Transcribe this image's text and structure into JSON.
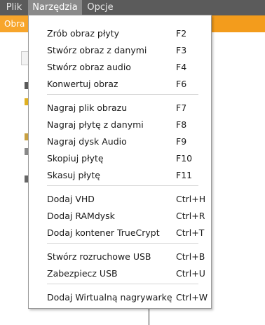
{
  "menubar": {
    "items": [
      {
        "label": "Plik"
      },
      {
        "label": "Narzędzia"
      },
      {
        "label": "Opcje"
      }
    ]
  },
  "toolbar": {
    "tab_label": "Obra"
  },
  "colors": {
    "menubar": "#5b5b5b",
    "active_menu": "#8a8a8a",
    "toolbar": "#f39c1c"
  },
  "dropdown": {
    "items": [
      {
        "label": "Zrób obraz płyty",
        "shortcut": "F2"
      },
      {
        "label": "Stwórz obraz z danymi",
        "shortcut": "F3"
      },
      {
        "label": "Stwórz obraz audio",
        "shortcut": "F4"
      },
      {
        "label": "Konwertuj obraz",
        "shortcut": "F6"
      },
      {
        "label": "Nagraj plik obrazu",
        "shortcut": "F7"
      },
      {
        "label": "Nagraj płytę z danymi",
        "shortcut": "F8"
      },
      {
        "label": "Nagraj dysk Audio",
        "shortcut": "F9"
      },
      {
        "label": "Skopiuj płytę",
        "shortcut": "F10"
      },
      {
        "label": "Skasuj płytę",
        "shortcut": "F11"
      },
      {
        "label": "Dodaj VHD",
        "shortcut": "Ctrl+H"
      },
      {
        "label": "Dodaj RAMdysk",
        "shortcut": "Ctrl+R"
      },
      {
        "label": "Dodaj kontener TrueCrypt",
        "shortcut": "Ctrl+T"
      },
      {
        "label": "Stwórz rozruchowe USB",
        "shortcut": "Ctrl+B"
      },
      {
        "label": "Zabezpiecz USB",
        "shortcut": "Ctrl+U"
      },
      {
        "label": "Dodaj Wirtualną nagrywarkę",
        "shortcut": "Ctrl+W"
      }
    ]
  }
}
